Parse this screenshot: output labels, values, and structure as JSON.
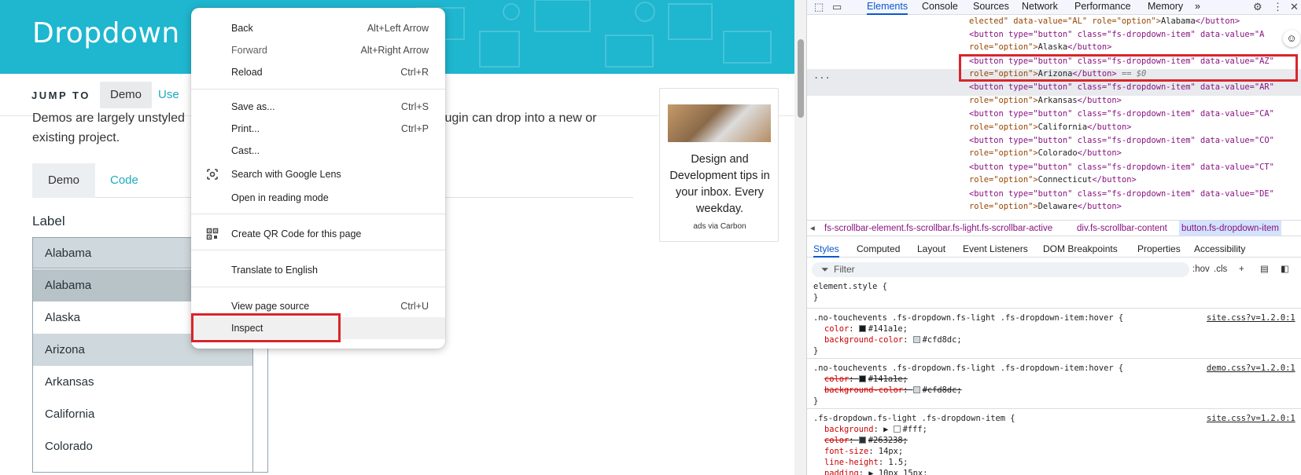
{
  "page": {
    "title": "Dropdown",
    "jump_to": "JUMP TO",
    "jump_demo": "Demo",
    "jump_use": "Use",
    "intro_line1": "Demos are largely unstyled",
    "intro_line1b": "plugin can drop into a new or",
    "intro_line2": "existing project.",
    "tab_demo": "Demo",
    "tab_code": "Code",
    "field_label": "Label",
    "dropdown_selected": "Alabama",
    "dropdown_items": [
      "Alabama",
      "Alaska",
      "Arizona",
      "Arkansas",
      "California",
      "Colorado"
    ],
    "ad_text": "Design and Development tips in your inbox. Every weekday.",
    "ad_via": "ads via Carbon"
  },
  "context_menu": {
    "back": "Back",
    "back_sc": "Alt+Left Arrow",
    "forward": "Forward",
    "forward_sc": "Alt+Right Arrow",
    "reload": "Reload",
    "reload_sc": "Ctrl+R",
    "save_as": "Save as...",
    "save_as_sc": "Ctrl+S",
    "print": "Print...",
    "print_sc": "Ctrl+P",
    "cast": "Cast...",
    "lens": "Search with Google Lens",
    "reading": "Open in reading mode",
    "qr": "Create QR Code for this page",
    "translate": "Translate to English",
    "view_source": "View page source",
    "view_source_sc": "Ctrl+U",
    "inspect": "Inspect"
  },
  "devtools": {
    "tabs": [
      "Elements",
      "Console",
      "Sources",
      "Network",
      "Performance",
      "Memory"
    ],
    "more": "»",
    "dom": {
      "l0_pre": "elected\" data-value=\"AL\" role=\"option\">",
      "l0_text": "Alabama",
      "l1": "<button type=\"button\" class=\"fs-dropdown-item\" data-value=\"A",
      "l2_pre": "role=\"option\">",
      "l2_text": "Alaska",
      "l3": "<button type=\"button\" class=\"fs-dropdown-item\" data-value=\"AZ\"",
      "l4_pre": "role=\"option\">",
      "l4_text": "Arizona",
      "l4_eq": " == $0",
      "l5": "<button type=\"button\" class=\"fs-dropdown-item\" data-value=\"AR\"",
      "l6_pre": "role=\"option\">",
      "l6_text": "Arkansas",
      "l7": "<button type=\"button\" class=\"fs-dropdown-item\" data-value=\"CA\"",
      "l8_pre": "role=\"option\">",
      "l8_text": "California",
      "l9": "<button type=\"button\" class=\"fs-dropdown-item\" data-value=\"CO\"",
      "l10_pre": "role=\"option\">",
      "l10_text": "Colorado",
      "l11": "<button type=\"button\" class=\"fs-dropdown-item\" data-value=\"CT\"",
      "l12_pre": "role=\"option\">",
      "l12_text": "Connecticut",
      "l13": "<button type=\"button\" class=\"fs-dropdown-item\" data-value=\"DE\"",
      "l14_pre": "role=\"option\">",
      "l14_text": "Delaware",
      "dots": "..."
    },
    "breadcrumb": [
      "fs-scrollbar-element.fs-scrollbar.fs-light.fs-scrollbar-active",
      "div.fs-scrollbar-content",
      "button.fs-dropdown-item"
    ],
    "style_tabs": [
      "Styles",
      "Computed",
      "Layout",
      "Event Listeners",
      "DOM Breakpoints",
      "Properties",
      "Accessibility"
    ],
    "filter_placeholder": "Filter",
    "hov": ":hov",
    "cls": ".cls",
    "rules": {
      "r0_sel": "element.style {",
      "close": "}",
      "r1_sel": ".no-touchevents .fs-dropdown.fs-light .fs-dropdown-item:hover {",
      "r1_src": "site.css?v=1.2.0:1",
      "r1_p1": "color",
      "r1_v1": "#141a1e;",
      "r1_p2": "background-color",
      "r1_v2": "#cfd8dc;",
      "r2_sel": ".no-touchevents .fs-dropdown.fs-light .fs-dropdown-item:hover {",
      "r2_src": "demo.css?v=1.2.0:1",
      "r2_p1": "color",
      "r2_v1": "#141a1e;",
      "r2_p2": "background-color",
      "r2_v2": "#cfd8dc;",
      "r3_sel": ".fs-dropdown.fs-light .fs-dropdown-item {",
      "r3_src": "site.css?v=1.2.0:1",
      "r3_p1": "background",
      "r3_v1": "#fff;",
      "r3_p2": "color",
      "r3_v2": "#263238;",
      "r3_p3": "font-size",
      "r3_v3": "14px;",
      "r3_p4": "line-height",
      "r3_v4": "1.5;",
      "r3_p5": "padding",
      "r3_v5": "10px 15px;"
    },
    "colors": {
      "accent": "#0b57d0",
      "highlight": "#d9252a"
    }
  }
}
